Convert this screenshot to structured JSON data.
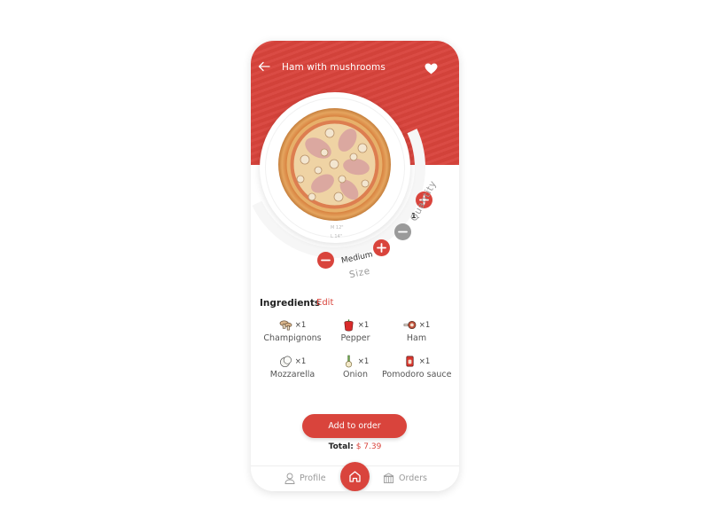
{
  "header": {
    "title": "Ham with mushrooms",
    "back_icon": "arrow-left-icon",
    "favorite_icon": "heart-icon"
  },
  "pizza": {
    "size_marks": [
      "M 12\"",
      "L 14\""
    ]
  },
  "quantity": {
    "label": "Quantity",
    "value": "1",
    "increment_icon": "plus-icon",
    "decrement_icon": "minus-icon"
  },
  "size": {
    "label": "Size",
    "value": "Medium",
    "increment_icon": "plus-icon",
    "decrement_icon": "minus-icon"
  },
  "ingredients": {
    "title": "Ingredients",
    "edit_label": "Edit",
    "items": [
      {
        "name": "Champignons",
        "count": "×1",
        "icon": "mushroom-icon"
      },
      {
        "name": "Pepper",
        "count": "×1",
        "icon": "bell-pepper-icon"
      },
      {
        "name": "Ham",
        "count": "×1",
        "icon": "ham-icon"
      },
      {
        "name": "Mozzarella",
        "count": "×1",
        "icon": "mozzarella-icon"
      },
      {
        "name": "Onion",
        "count": "×1",
        "icon": "onion-icon"
      },
      {
        "name": "Pomodoro sauce",
        "count": "×1",
        "icon": "sauce-bottle-icon"
      }
    ]
  },
  "order": {
    "add_label": "Add to order",
    "total_label": "Total:",
    "total_value": "$ 7.39"
  },
  "nav": {
    "profile_label": "Profile",
    "orders_label": "Orders",
    "home_icon": "home-icon"
  },
  "colors": {
    "accent": "#d9443c",
    "muted": "#9a9a9a"
  }
}
